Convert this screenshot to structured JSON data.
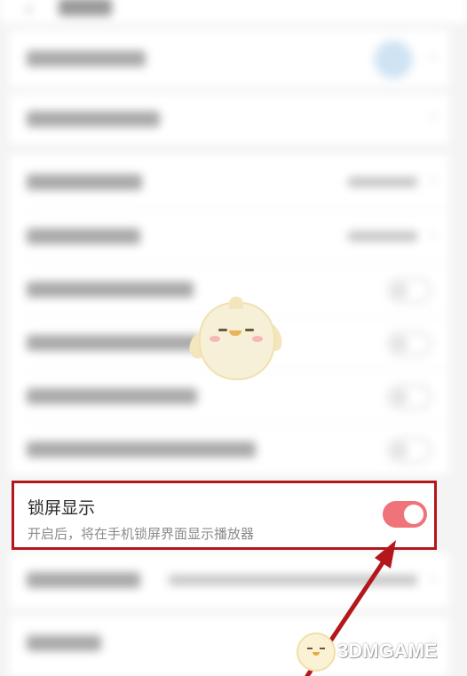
{
  "header": {
    "back_icon": "back-arrow-icon"
  },
  "highlighted_setting": {
    "title": "锁屏显示",
    "description": "开启后，将在手机锁屏界面显示播放器",
    "toggle_state": "on",
    "toggle_color": "#f0737a"
  },
  "annotation": {
    "box_color": "#b3171b",
    "arrow_color": "#b3171b"
  },
  "watermark": {
    "text": "3DMGAME"
  },
  "icons": {
    "chevron": "chevron-right-icon"
  },
  "chevron_glyph": "›"
}
